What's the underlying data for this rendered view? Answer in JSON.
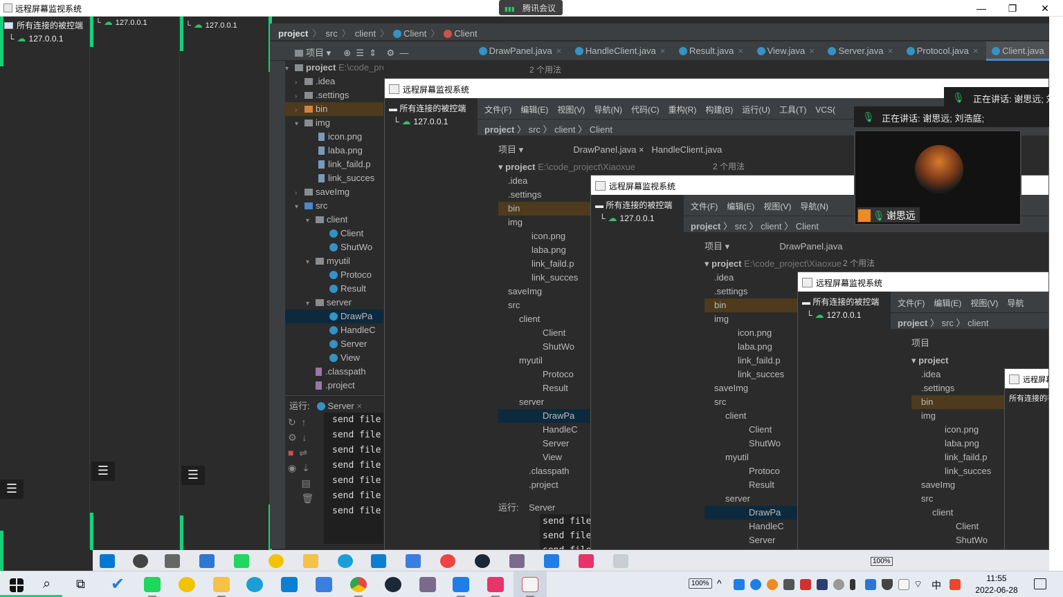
{
  "window": {
    "title": "远程屏幕监视系统",
    "meeting_label": "腾讯会议"
  },
  "tree": {
    "root_label": "所有连接的被控端",
    "host": "127.0.0.1"
  },
  "strips": [
    {
      "host": "127.0.0.1"
    },
    {
      "host": "127.0.0.1"
    }
  ],
  "ide": {
    "breadcrumb": {
      "project": "project",
      "src": "src",
      "pkg": "client",
      "cls1": "Client",
      "cls2": "Client"
    },
    "project_header": "项目",
    "usages": "2 个用法",
    "tabs": [
      {
        "label": "DrawPanel.java"
      },
      {
        "label": "HandleClient.java"
      },
      {
        "label": "Result.java"
      },
      {
        "label": "View.java"
      },
      {
        "label": "Server.java"
      },
      {
        "label": "Protocol.java"
      },
      {
        "label": "Client.java"
      }
    ],
    "tree": {
      "project": "project",
      "project_path": "E:\\code_project\\Xiaoxue",
      "idea": ".idea",
      "settings": ".settings",
      "bin": "bin",
      "img": "img",
      "icon": "icon.png",
      "laba": "laba.png",
      "linkf": "link_faild.p",
      "links": "link_succes",
      "saveimg": "saveImg",
      "src": "src",
      "client": "client",
      "client_cls": "Client",
      "shutw": "ShutWo",
      "myutil": "myutil",
      "protoc": "Protoco",
      "result": "Result",
      "server": "server",
      "drawpa": "DrawPa",
      "handle": "HandleC",
      "server_cls": "Server",
      "view": "View",
      "classpath": ".classpath",
      "dotproject": ".project"
    },
    "run": {
      "label": "运行:",
      "config": "Server",
      "lines": [
        "send file",
        "send file",
        "send file",
        "send file",
        "send file",
        "send file",
        "send file"
      ]
    }
  },
  "nested": {
    "menu": [
      "文件(F)",
      "编辑(E)",
      "视图(V)",
      "导航(N)",
      "代码(C)",
      "重构(R)",
      "构建(B)",
      "运行(U)",
      "工具(T)",
      "VCS("
    ],
    "menu2": [
      "文件(F)",
      "编辑(E)",
      "视图(V)",
      "导航(N)"
    ],
    "menu3": [
      "文件(F)",
      "编辑(E)",
      "视图(V)",
      "导航"
    ]
  },
  "meeting": {
    "speaking_label": "正在讲话: 谢思远; 刘浩庭;",
    "speaking_label_short": "正在讲话: 谢思远; 刘",
    "participant": "谢思远"
  },
  "taskbar": {
    "battery": "100%",
    "time": "11:55",
    "date": "2022-06-28",
    "ime": "中"
  }
}
